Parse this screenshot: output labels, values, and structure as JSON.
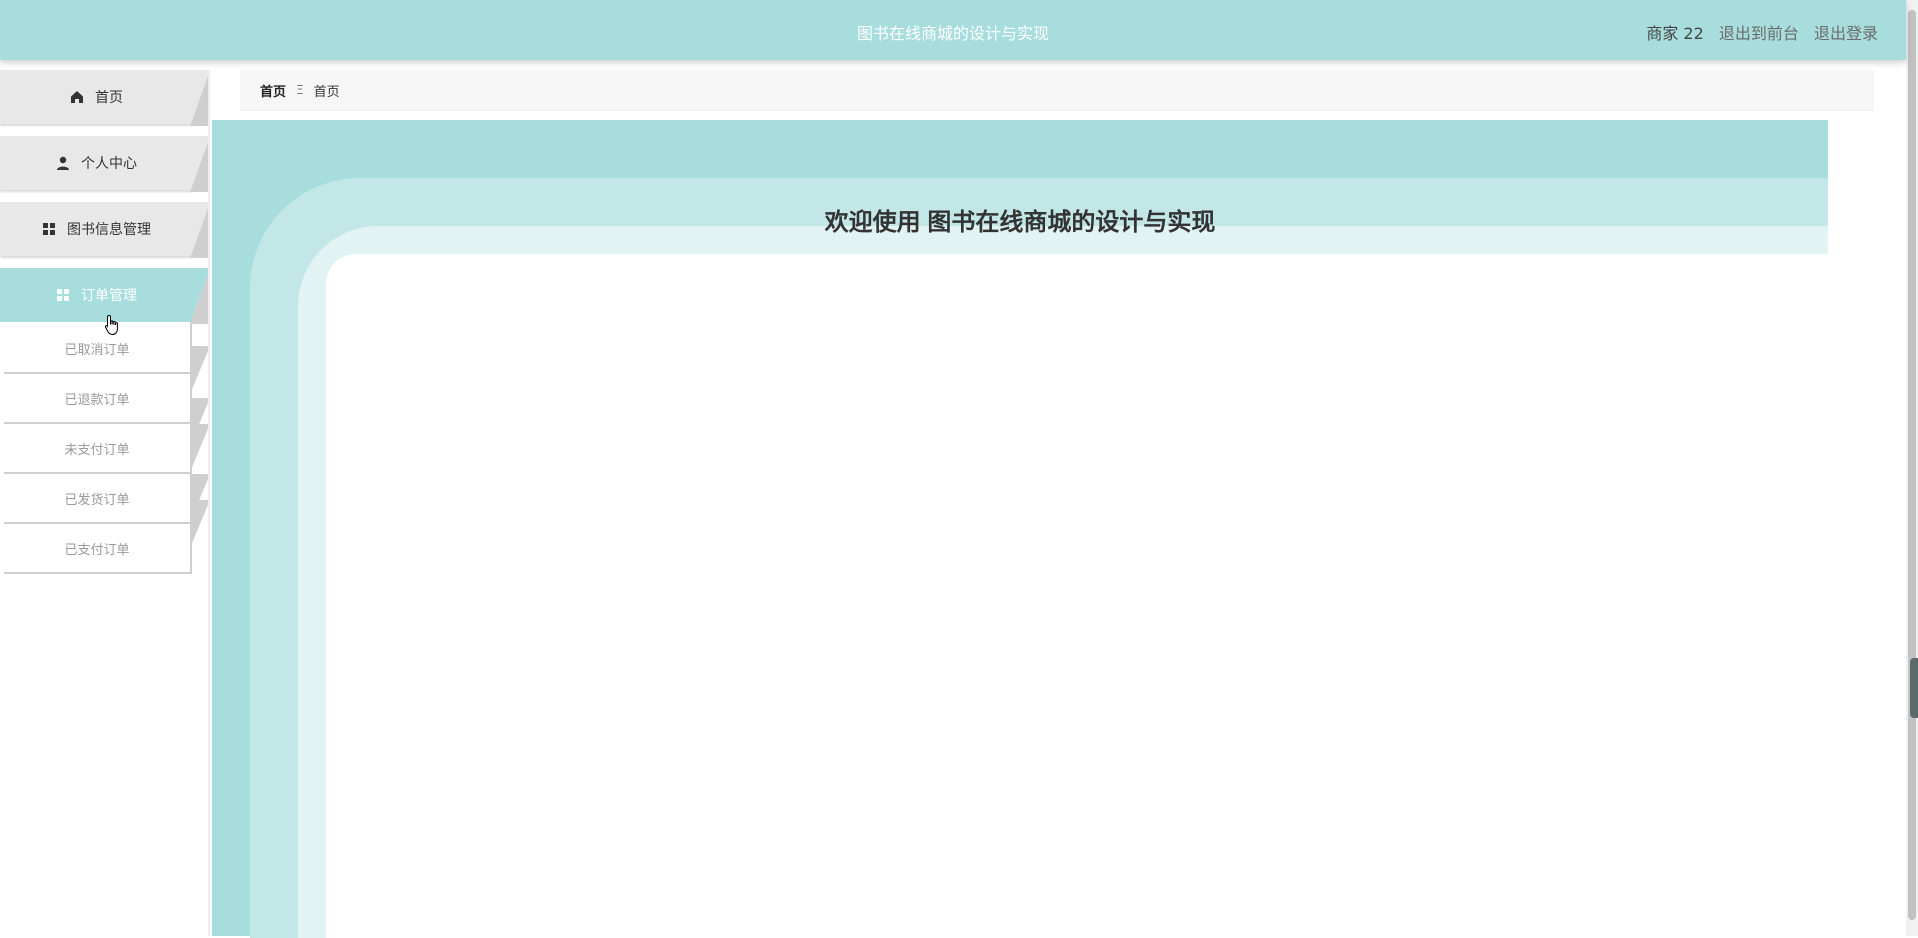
{
  "header": {
    "title": "图书在线商城的设计与实现",
    "user": "商家 22",
    "to_front": "退出到前台",
    "logout": "退出登录"
  },
  "sidebar": {
    "items": [
      {
        "label": "首页",
        "icon": "home-icon"
      },
      {
        "label": "个人中心",
        "icon": "user-icon"
      },
      {
        "label": "图书信息管理",
        "icon": "grid-icon"
      },
      {
        "label": "订单管理",
        "icon": "grid-icon",
        "active": true
      }
    ],
    "order_submenu": [
      {
        "label": "已取消订单"
      },
      {
        "label": "已退款订单"
      },
      {
        "label": "未支付订单"
      },
      {
        "label": "已发货订单"
      },
      {
        "label": "已支付订单"
      }
    ]
  },
  "breadcrumb": {
    "first": "首页",
    "separator": "Ξ",
    "current": "首页"
  },
  "main": {
    "welcome": "欢迎使用 图书在线商城的设计与实现"
  },
  "colors": {
    "accent": "#a8dddd",
    "band_mid": "#c3e6e7",
    "band_light": "#e2f3f3"
  }
}
